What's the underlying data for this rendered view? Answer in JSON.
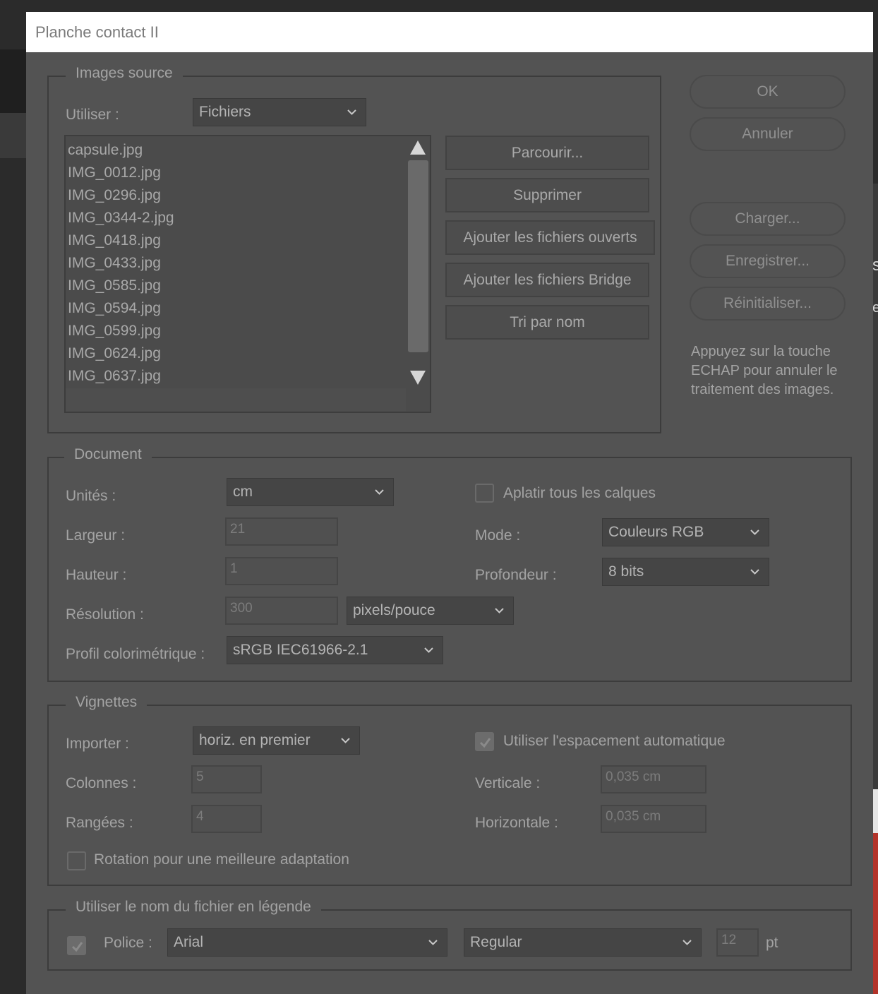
{
  "window": {
    "title": "Planche contact II"
  },
  "background": {
    "right_letter_1": "s",
    "right_letter_2": "e"
  },
  "source": {
    "legend": "Images source",
    "use_label": "Utiliser :",
    "use_value": "Fichiers",
    "files": [
      "capsule.jpg",
      "IMG_0012.jpg",
      "IMG_0296.jpg",
      "IMG_0344-2.jpg",
      "IMG_0418.jpg",
      "IMG_0433.jpg",
      "IMG_0585.jpg",
      "IMG_0594.jpg",
      "IMG_0599.jpg",
      "IMG_0624.jpg",
      "IMG_0637.jpg"
    ],
    "buttons": {
      "browse": "Parcourir...",
      "remove": "Supprimer",
      "add_open": "Ajouter les fichiers ouverts",
      "add_bridge": "Ajouter les fichiers Bridge",
      "sort": "Tri par nom"
    }
  },
  "actions": {
    "ok": "OK",
    "cancel": "Annuler",
    "load": "Charger...",
    "save": "Enregistrer...",
    "reset": "Réinitialiser...",
    "hint": "Appuyez sur la touche ECHAP pour annuler le traitement des images."
  },
  "document": {
    "legend": "Document",
    "units_label": "Unités :",
    "units_value": "cm",
    "width_label": "Largeur :",
    "width_value": "21",
    "height_label": "Hauteur :",
    "height_value": "1",
    "resolution_label": "Résolution :",
    "resolution_value": "300",
    "resolution_unit": "pixels/pouce",
    "profile_label": "Profil colorimétrique :",
    "profile_value": "sRGB IEC61966-2.1",
    "flatten_label": "Aplatir tous les calques",
    "flatten_checked": false,
    "mode_label": "Mode :",
    "mode_value": "Couleurs RGB",
    "depth_label": "Profondeur :",
    "depth_value": "8 bits"
  },
  "thumbnails": {
    "legend": "Vignettes",
    "place_label": "Importer :",
    "place_value": "horiz. en premier",
    "columns_label": "Colonnes :",
    "columns_value": "5",
    "rows_label": "Rangées :",
    "rows_value": "4",
    "auto_spacing_label": "Utiliser l'espacement automatique",
    "auto_spacing_checked": true,
    "vertical_label": "Verticale :",
    "vertical_value": "0,035 cm",
    "horizontal_label": "Horizontale :",
    "horizontal_value": "0,035 cm",
    "rotate_label": "Rotation pour une meilleure adaptation",
    "rotate_checked": false
  },
  "caption": {
    "legend": "Utiliser le nom du fichier en légende",
    "enabled": true,
    "font_label": "Police :",
    "font_value": "Arial",
    "style_value": "Regular",
    "size_value": "12",
    "size_unit": "pt"
  }
}
